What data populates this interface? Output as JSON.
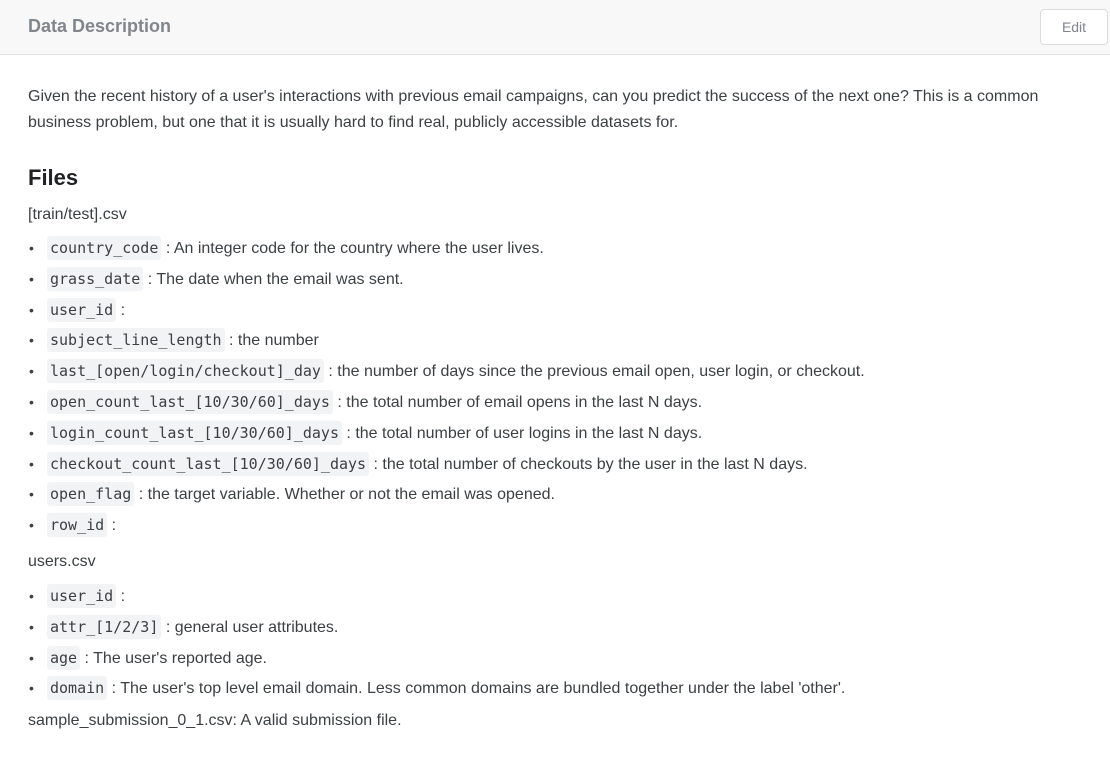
{
  "header": {
    "title": "Data Description",
    "edit_label": "Edit"
  },
  "intro": "Given the recent history of a user's interactions with previous email campaigns, can you predict the success of the next one? This is a common business problem, but one that it is usually hard to find real, publicly accessible datasets for.",
  "files_heading": "Files",
  "train_test": {
    "file_name": "[train/test].csv",
    "fields": [
      {
        "code": "country_code",
        "desc": " : An integer code for the country where the user lives."
      },
      {
        "code": "grass_date",
        "desc": " : The date when the email was sent."
      },
      {
        "code": "user_id",
        "desc": " :"
      },
      {
        "code": "subject_line_length",
        "desc": " : the number"
      },
      {
        "code": "last_[open/login/checkout]_day",
        "desc": " : the number of days since the previous email open, user login, or checkout."
      },
      {
        "code": "open_count_last_[10/30/60]_days",
        "desc": " : the total number of email opens in the last N days."
      },
      {
        "code": "login_count_last_[10/30/60]_days",
        "desc": " : the total number of user logins in the last N days."
      },
      {
        "code": "checkout_count_last_[10/30/60]_days",
        "desc": " : the total number of checkouts by the user in the last N days."
      },
      {
        "code": "open_flag",
        "desc": " : the target variable. Whether or not the email was opened."
      },
      {
        "code": "row_id",
        "desc": " :"
      }
    ]
  },
  "users": {
    "file_name": "users.csv",
    "fields": [
      {
        "code": "user_id",
        "desc": " :"
      },
      {
        "code": "attr_[1/2/3]",
        "desc": " : general user attributes."
      },
      {
        "code": "age",
        "desc": " : The user's reported age."
      },
      {
        "code": "domain",
        "desc": " : The user's top level email domain. Less common domains are bundled together under the label 'other'."
      }
    ]
  },
  "sample_submission": "sample_submission_0_1.csv: A valid submission file.",
  "bullet_glyph": "•"
}
